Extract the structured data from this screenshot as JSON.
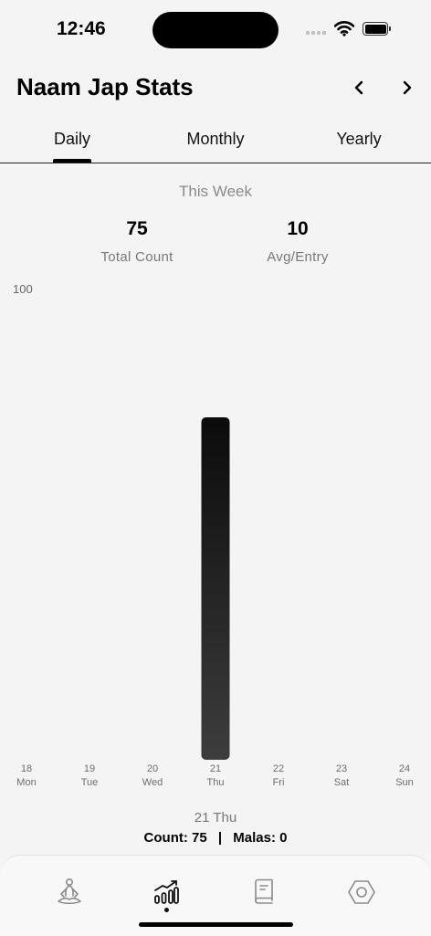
{
  "status_bar": {
    "time": "12:46"
  },
  "header": {
    "title": "Naam Jap Stats",
    "prev_icon": "chevron-left-icon",
    "next_icon": "chevron-right-icon"
  },
  "tabs": [
    {
      "label": "Daily",
      "active": true
    },
    {
      "label": "Monthly",
      "active": false
    },
    {
      "label": "Yearly",
      "active": false
    }
  ],
  "summary": {
    "period": "This Week",
    "total_count": {
      "value": "75",
      "label": "Total Count"
    },
    "avg_entry": {
      "value": "10",
      "label": "Avg/Entry"
    }
  },
  "chart_data": {
    "type": "bar",
    "max_label": "100",
    "ylim": [
      0,
      100
    ],
    "categories": [
      {
        "date": "18",
        "day": "Mon"
      },
      {
        "date": "19",
        "day": "Tue"
      },
      {
        "date": "20",
        "day": "Wed"
      },
      {
        "date": "21",
        "day": "Thu"
      },
      {
        "date": "22",
        "day": "Fri"
      },
      {
        "date": "23",
        "day": "Sat"
      },
      {
        "date": "24",
        "day": "Sun"
      }
    ],
    "values": [
      0,
      0,
      0,
      75,
      0,
      0,
      0
    ],
    "bar_color_top": "#0b0b0b",
    "bar_color_bottom": "#3d3d3d"
  },
  "selection": {
    "date": "21 Thu",
    "count_label": "Count: 75",
    "separator": "|",
    "malas_label": "Malas: 0"
  },
  "bottom_nav": [
    {
      "icon": "meditation-icon",
      "active": false
    },
    {
      "icon": "stats-chart-icon",
      "active": true
    },
    {
      "icon": "journal-icon",
      "active": false
    },
    {
      "icon": "settings-hexagon-icon",
      "active": false
    }
  ]
}
